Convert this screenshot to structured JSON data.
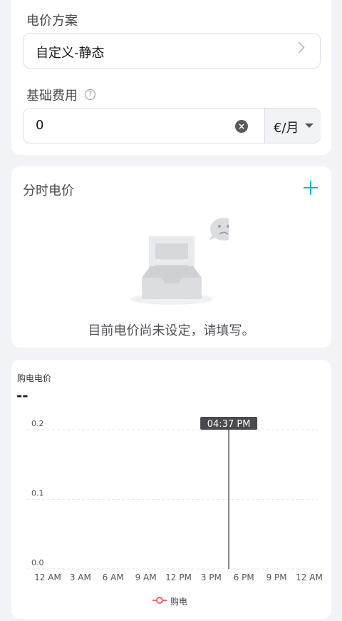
{
  "plan": {
    "label": "电价方案",
    "value": "自定义-静态",
    "icon": "chevron-right-icon"
  },
  "base_fee": {
    "label": "基础费用",
    "help_icon": "help-circle-icon",
    "value": "0",
    "clear_icon": "clear-icon",
    "unit": "€/月",
    "unit_icon": "caret-down-icon"
  },
  "tou": {
    "title": "分时电价",
    "add_icon": "plus-icon",
    "empty_icon": "empty-inbox-icon",
    "empty_text": "目前电价尚未设定，请填写。"
  },
  "chart_section": {
    "title": "购电电价",
    "current_value": "--",
    "tooltip": "04:37 PM",
    "legend": "购电",
    "legend_color": "#f06473",
    "grid_color": "#e4e4e8",
    "cursor_color": "#555555"
  },
  "chart_data": {
    "type": "line",
    "x": [
      "12 AM",
      "3 AM",
      "6 AM",
      "9 AM",
      "12 PM",
      "3 PM",
      "6 PM",
      "9 PM",
      "12 AM"
    ],
    "series": [
      {
        "name": "购电",
        "values": []
      }
    ],
    "ylim": [
      0,
      0.2
    ],
    "yticks": [
      "0.0",
      "0.1",
      "0.2"
    ],
    "cursor_x": "04:37 PM",
    "grid": true,
    "legend_position": "bottom-center"
  }
}
